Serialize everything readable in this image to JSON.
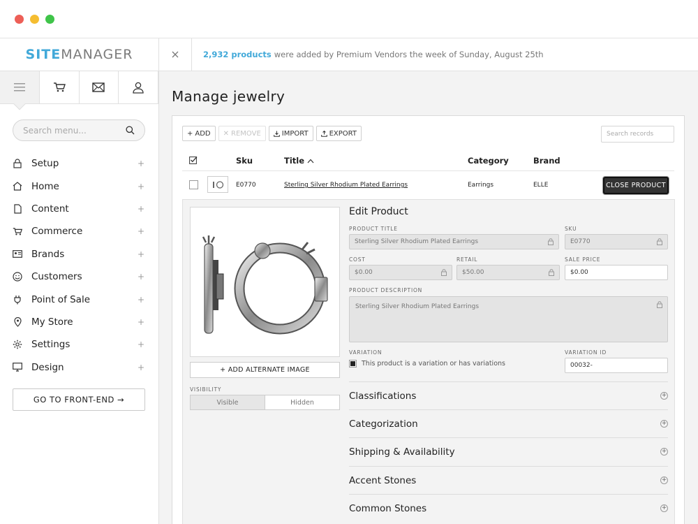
{
  "sidebar": {
    "logo_part1": "SITE",
    "logo_part2": "MANAGER",
    "iconbar": [
      "menu-icon",
      "cart-icon",
      "mail-icon",
      "user-icon"
    ],
    "search_placeholder": "Search menu...",
    "items": [
      {
        "label": "Setup",
        "icon": "lock-icon"
      },
      {
        "label": "Home",
        "icon": "home-icon"
      },
      {
        "label": "Content",
        "icon": "document-icon"
      },
      {
        "label": "Commerce",
        "icon": "cart-icon"
      },
      {
        "label": "Brands",
        "icon": "id-card-icon"
      },
      {
        "label": "Customers",
        "icon": "smiley-icon"
      },
      {
        "label": "Point of Sale",
        "icon": "plug-icon"
      },
      {
        "label": "My Store",
        "icon": "map-pin-icon"
      },
      {
        "label": "Settings",
        "icon": "gear-icon"
      },
      {
        "label": "Design",
        "icon": "monitor-icon"
      }
    ],
    "plus": "+",
    "frontend_button": "GO TO FRONT-END →"
  },
  "notice": {
    "highlight": "2,932 products",
    "text": "were added by Premium Vendors the week of Sunday, August 25th"
  },
  "main": {
    "title": "Manage jewelry",
    "toolbar": {
      "add": "ADD",
      "remove": "REMOVE",
      "import": "IMPORT",
      "export": "EXPORT",
      "search_placeholder": "Search records"
    },
    "columns": {
      "sku": "Sku",
      "title": "Title",
      "category": "Category",
      "brand": "Brand"
    },
    "row": {
      "sku": "E0770",
      "title": "Sterling Silver Rhodium Plated Earrings",
      "category": "Earrings",
      "brand": "ELLE",
      "close_button": "CLOSE PRODUCT"
    },
    "edit": {
      "heading": "Edit Product",
      "product_title_label": "PRODUCT TITLE",
      "product_title_value": "Sterling Silver Rhodium Plated Earrings",
      "sku_label": "SKU",
      "sku_value": "E0770",
      "cost_label": "COST",
      "cost_value": "$0.00",
      "retail_label": "RETAIL",
      "retail_value": "$50.00",
      "sale_label": "SALE PRICE",
      "sale_value": "$0.00",
      "desc_label": "PRODUCT DESCRIPTION",
      "desc_value": "Sterling Silver Rhodium Plated Earrings",
      "variation_label": "VARIATION",
      "variation_text": "This product is a variation or has variations",
      "variation_id_label": "VARIATION ID",
      "variation_id_value": "00032-",
      "alt_image_button": "+ ADD ALTERNATE IMAGE",
      "visibility_label": "VISIBILITY",
      "visible": "Visible",
      "hidden": "Hidden",
      "sections": [
        "Classifications",
        "Categorization",
        "Shipping & Availability",
        "Accent Stones",
        "Common Stones"
      ]
    }
  }
}
